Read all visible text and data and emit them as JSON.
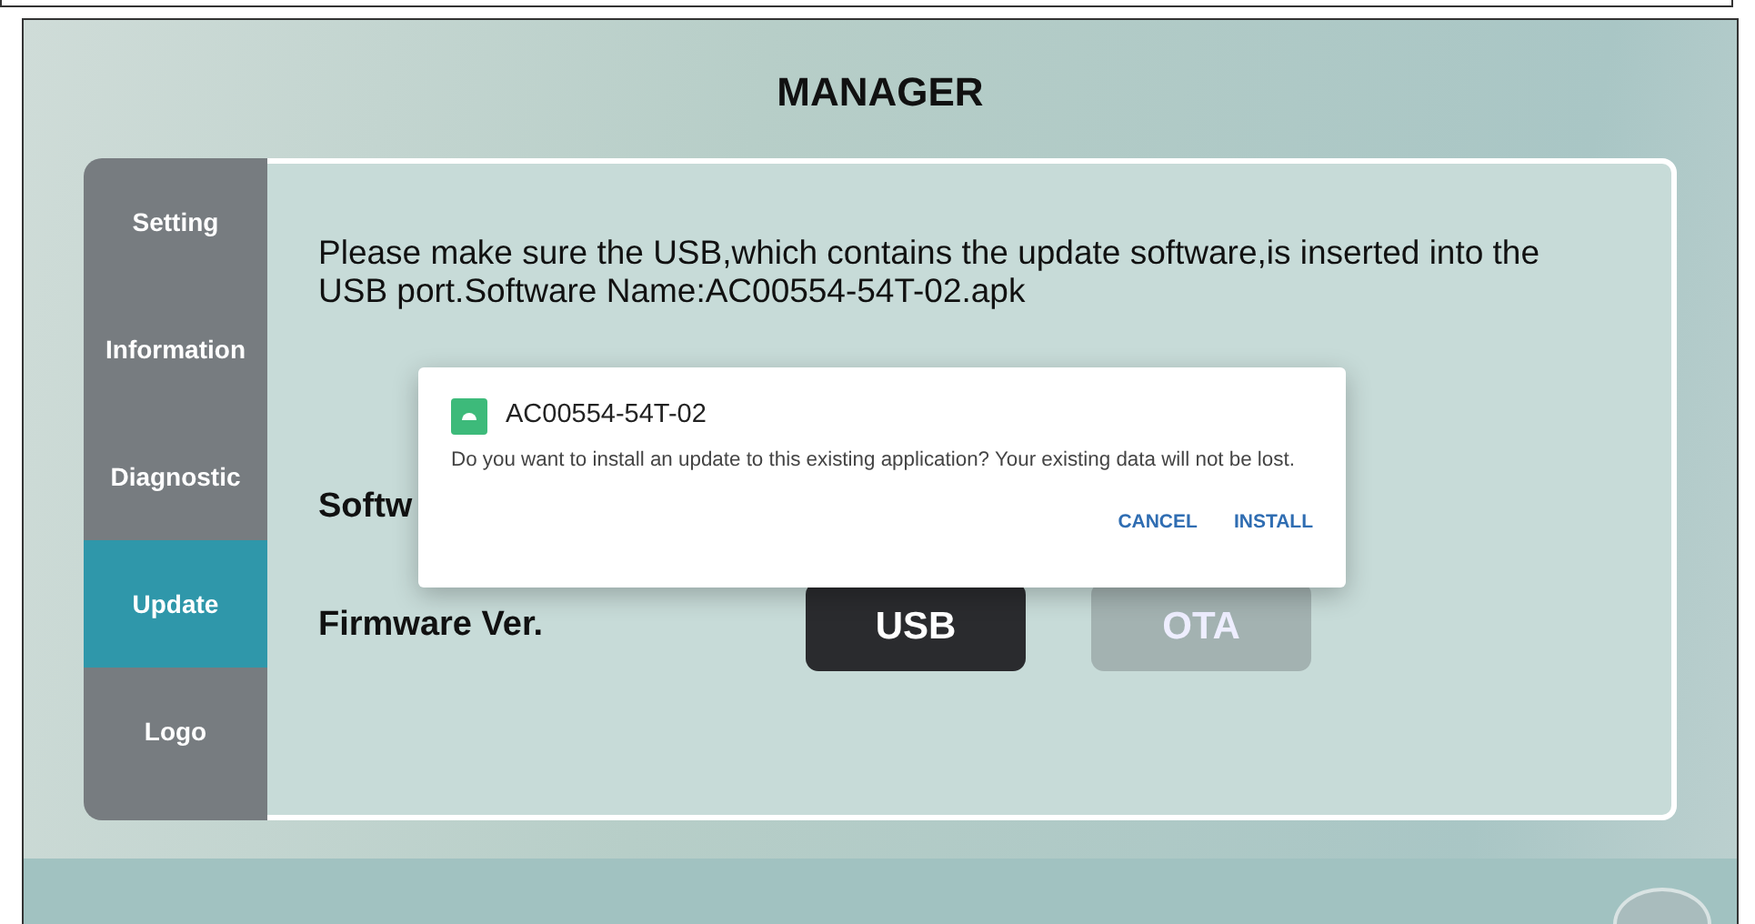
{
  "title": "MANAGER",
  "sidebar": {
    "items": [
      {
        "label": "Setting",
        "selected": false
      },
      {
        "label": "Information",
        "selected": false
      },
      {
        "label": "Diagnostic",
        "selected": false
      },
      {
        "label": "Update",
        "selected": true
      },
      {
        "label": "Logo",
        "selected": false
      }
    ]
  },
  "content": {
    "message": "Please make sure the USB,which contains the update software,is inserted into the USB port.Software Name:AC00554-54T-02.apk",
    "rows": [
      {
        "label": "Softw",
        "buttons": []
      },
      {
        "label": "Firmware Ver.",
        "buttons": [
          {
            "label": "USB",
            "disabled": false
          },
          {
            "label": "OTA",
            "disabled": true
          }
        ]
      }
    ]
  },
  "dialog": {
    "title": "AC00554-54T-02",
    "message": "Do you want to install an update to this existing application? Your existing data will not be lost.",
    "buttons": [
      "CANCEL",
      "INSTALL"
    ]
  }
}
